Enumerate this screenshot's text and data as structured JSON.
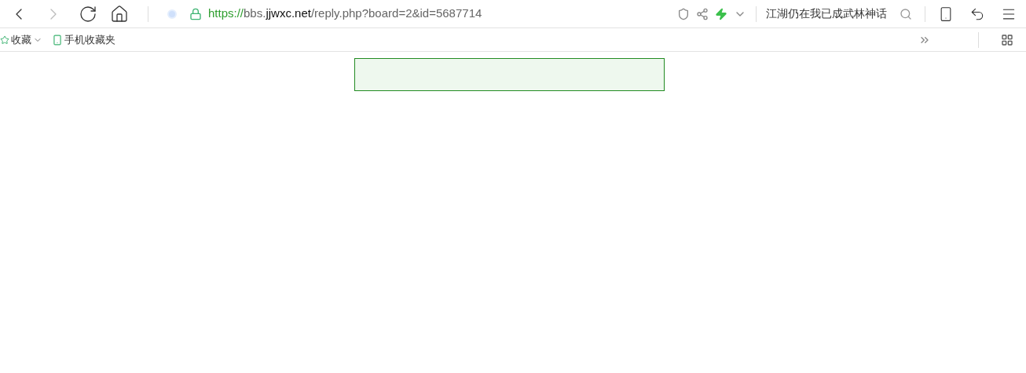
{
  "address_bar": {
    "url_parts": [
      {
        "kind": "scheme",
        "text": "https://"
      },
      {
        "kind": "sub",
        "text": "bbs."
      },
      {
        "kind": "domain",
        "text": "jjwxc.net"
      },
      {
        "kind": "path",
        "text": "/reply.php?board=2&id=5687714"
      }
    ],
    "secure": true
  },
  "search": {
    "value": "江湖仍在我已成武林神话"
  },
  "bookmarks": [
    {
      "label": "收藏",
      "kind": "menu"
    },
    {
      "label": "手机收藏夹",
      "kind": "mobile"
    }
  ]
}
